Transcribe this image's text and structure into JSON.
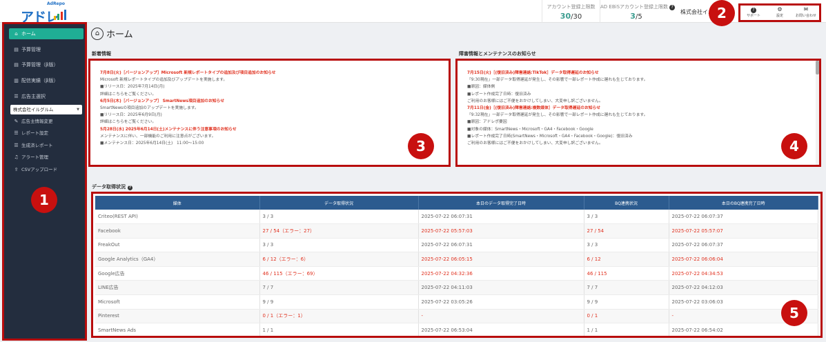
{
  "header": {
    "logo_text": "アドレポ",
    "logo_sub": "AdRepo",
    "account_limit_label": "アカウント登録上限数",
    "account_limit_current": "30",
    "account_limit_max": "/30",
    "ebis_limit_label": "AD EBiSアカウント登録上限数",
    "ebis_limit_current": "3",
    "ebis_limit_max": "/5",
    "company": "株式会社イル",
    "icons": [
      {
        "name": "support",
        "label": "サポート",
        "icon": "question-icon"
      },
      {
        "name": "settings",
        "label": "設定",
        "icon": "gear-icon"
      },
      {
        "name": "contact",
        "label": "お問い合わせ",
        "icon": "mail-icon"
      }
    ]
  },
  "sidebar": {
    "items": [
      {
        "label": "ホーム",
        "icon": "home-icon",
        "active": true
      },
      {
        "label": "予算管理",
        "icon": "document-icon"
      },
      {
        "label": "予算管理（β版）",
        "icon": "document-icon"
      },
      {
        "label": "配信実績（β版）",
        "icon": "chart-icon"
      },
      {
        "label": "広告主選択",
        "icon": "list-icon"
      }
    ],
    "selected_advertiser": "株式会社イルグルム",
    "sub_items": [
      {
        "label": "広告主情報変更",
        "icon": "edit-icon"
      },
      {
        "label": "レポート設定",
        "icon": "list-icon"
      },
      {
        "label": "生成済レポート",
        "icon": "list-icon"
      },
      {
        "label": "アラート管理",
        "icon": "bell-icon"
      },
      {
        "label": "CSVアップロード",
        "icon": "upload-icon"
      }
    ]
  },
  "page": {
    "title": "ホーム"
  },
  "news": {
    "title": "新着情報",
    "lines": [
      {
        "text": "7月8日(火)［バージョンアップ］Microsoft 新規レポートタイプの追加及び項目追加のお知らせ",
        "hl": true
      },
      {
        "text": "Microsoft 新規レポートタイプの追加及びアップデートを実施します。",
        "hl": false
      },
      {
        "text": "■リリース日：2025年7月14日(月)",
        "hl": false
      },
      {
        "text": "詳細はこちらをご覧ください。",
        "hl": false
      },
      {
        "text": "6月5日(木)［バージョンアップ］ SmartNews項目追加のお知らせ",
        "hl": true
      },
      {
        "text": "SmartNewsの項目追加のアップデートを実施します。",
        "hl": false
      },
      {
        "text": "■リリース日：2025年6月9日(月)",
        "hl": false
      },
      {
        "text": "詳細はこちらをご覧ください。",
        "hl": false
      },
      {
        "text": "5月28日(水) 2025年6月14日(土)メンテナンスに伴う注意事項のお知らせ",
        "hl": true
      },
      {
        "text": "メンテナンスに伴い、一部機能のご利用に注意点がございます。",
        "hl": false
      },
      {
        "text": "■メンテナンス日：2025年6月14日(土)　11:00～15:00",
        "hl": false
      }
    ]
  },
  "maintenance": {
    "title": "障害情報とメンテナンスのお知らせ",
    "lines": [
      {
        "text": "7月15日(火)［(復旧済み)障害連絡:TikTok］データ取得遅延のお知らせ",
        "hl": true
      },
      {
        "text": "「9:30現在」一部データ取得遅延が発生し、その影響で一部レポート作成に遅れも生じております。",
        "hl": false
      },
      {
        "text": "■原因：媒体側",
        "hl": false
      },
      {
        "text": "■レポート作成完了日時：復旧済み",
        "hl": false
      },
      {
        "text": "ご利用のお客様にはご不便をおかけしてしまい、大変申し訳ございません。",
        "hl": false
      },
      {
        "text": "7月11日(金)［(復旧済み)障害連絡:複数媒体］データ取得遅延のお知らせ",
        "hl": true
      },
      {
        "text": "「9:32現在」一部データ取得遅延が発生し、その影響で一部レポート作成に遅れも生じております。",
        "hl": false
      },
      {
        "text": "■原因：アドレポ要因",
        "hl": false
      },
      {
        "text": "■対象の媒体：SmartNews・Microsoft・GA4・Facebook・Google",
        "hl": false
      },
      {
        "text": "■レポート作成完了日時(SmartNews・Microsoft・GA4・Facebook・Google)：復旧済み",
        "hl": false
      },
      {
        "text": "ご利用のお客様にはご不便をおかけしてしまい、大変申し訳ございません。",
        "hl": false
      }
    ]
  },
  "data_status": {
    "title": "データ取得状況",
    "columns": [
      "媒体",
      "データ取得状況",
      "本日のデータ取得完了日時",
      "BQ連携状況",
      "本日のBQ連携完了日時"
    ],
    "rows": [
      {
        "cells": [
          "Criteo(REST API)",
          "3 / 3",
          "2025-07-22 06:07:31",
          "3 / 3",
          "2025-07-22 06:07:37"
        ],
        "err": false
      },
      {
        "cells": [
          "Facebook",
          "27 / 54（エラー：27）",
          "2025-07-22 05:57:03",
          "27 / 54",
          "2025-07-22 05:57:07"
        ],
        "err": true
      },
      {
        "cells": [
          "FreakOut",
          "3 / 3",
          "2025-07-22 06:07:31",
          "3 / 3",
          "2025-07-22 06:07:37"
        ],
        "err": false
      },
      {
        "cells": [
          "Google Analytics（GA4）",
          "6 / 12（エラー：6）",
          "2025-07-22 06:05:15",
          "6 / 12",
          "2025-07-22 06:06:04"
        ],
        "err": true
      },
      {
        "cells": [
          "Google広告",
          "46 / 115（エラー：69）",
          "2025-07-22 04:32:36",
          "46 / 115",
          "2025-07-22 04:34:53"
        ],
        "err": true
      },
      {
        "cells": [
          "LINE広告",
          "7 / 7",
          "2025-07-22 04:11:03",
          "7 / 7",
          "2025-07-22 04:12:03"
        ],
        "err": false
      },
      {
        "cells": [
          "Microsoft",
          "9 / 9",
          "2025-07-22 03:05:26",
          "9 / 9",
          "2025-07-22 03:06:03"
        ],
        "err": false
      },
      {
        "cells": [
          "Pinterest",
          "0 / 1（エラー：1）",
          "-",
          "0 / 1",
          "-"
        ],
        "err": true
      },
      {
        "cells": [
          "SmartNews Ads",
          "1 / 1",
          "2025-07-22 06:53:04",
          "1 / 1",
          "2025-07-22 06:54:02"
        ],
        "err": false
      }
    ]
  },
  "badges": [
    "1",
    "2",
    "3",
    "4",
    "5"
  ],
  "colors": {
    "accent": "#1fae95",
    "sidebar": "#232d3e",
    "table_header": "#2c5b8f",
    "error": "#e0301e",
    "annotation": "#c8100f"
  }
}
